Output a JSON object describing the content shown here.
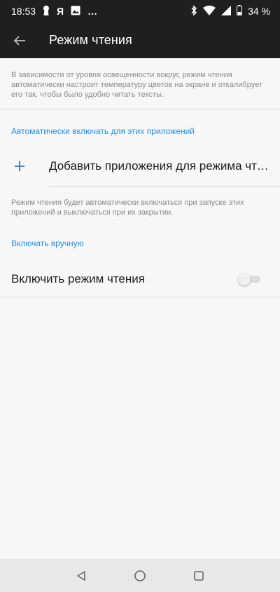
{
  "status_bar": {
    "time": "18:53",
    "notif_icons": [
      "keyhole-icon",
      "yandex-icon",
      "image-icon",
      "more-dots-icon"
    ],
    "yandex_letter": "Я",
    "battery": "34 %"
  },
  "app_bar": {
    "title": "Режим чтения"
  },
  "intro": {
    "text": "В зависимости от уровня освещенности вокруг, режим чтения автоматически настроит температуру цветов на экране и откалибрует его так, чтобы было удобно читать тексты."
  },
  "auto_section": {
    "title": "Автоматически включать для этих приложений",
    "add_label": "Добавить приложения для режима чтения",
    "note": "Режим чтения будет автоматически включаться при запуске этих приложений и выключаться при их закрытии."
  },
  "manual_section": {
    "title": "Включать вручную",
    "toggle_label": "Включить режим чтения",
    "toggle_on": false
  },
  "colors": {
    "accent": "#2a8ee0",
    "bar": "#1f1f1f",
    "background": "#f7f7f7"
  }
}
